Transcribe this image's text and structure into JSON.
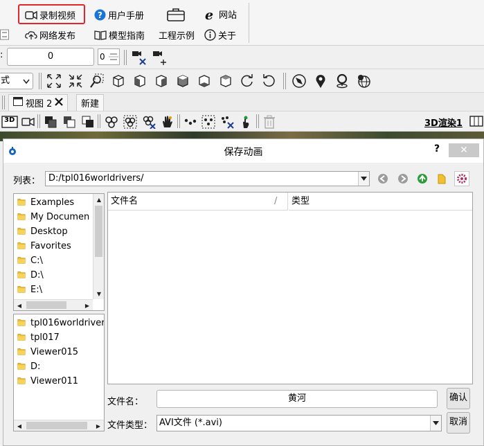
{
  "ribbon": {
    "record_video": "录制视频",
    "user_manual": "用户手册",
    "engineering_examples": "工程示例",
    "website": "网站",
    "network_publish": "网络发布",
    "model_guide": "模型指南",
    "about": "关于"
  },
  "toolbar": {
    "spin_value": "0",
    "spin_small_value": "0",
    "mode_select": "式"
  },
  "tabs": {
    "view2": "视图 2",
    "new": "新建"
  },
  "render": {
    "label": "3D渲染1",
    "badge_3d": "3D"
  },
  "dialog": {
    "title": "保存动画",
    "help": "?",
    "list_label": "列表：",
    "path": "D:/tpl016worldrivers/",
    "sidebar_top": [
      "Examples",
      "My Documen",
      "Desktop",
      "Favorites",
      "C:\\",
      "D:\\",
      "E:\\"
    ],
    "sidebar_bottom": [
      "tpl016worldriver",
      "tpl017",
      "Viewer015",
      "D:",
      "Viewer011"
    ],
    "col_name": "文件名",
    "col_type": "类型",
    "filename_label": "文件名：",
    "filename_value": "黄河",
    "filetype_label": "文件类型：",
    "filetype_value": "AVI文件 (*.avi)",
    "ok": "确认",
    "cancel": "取消"
  }
}
